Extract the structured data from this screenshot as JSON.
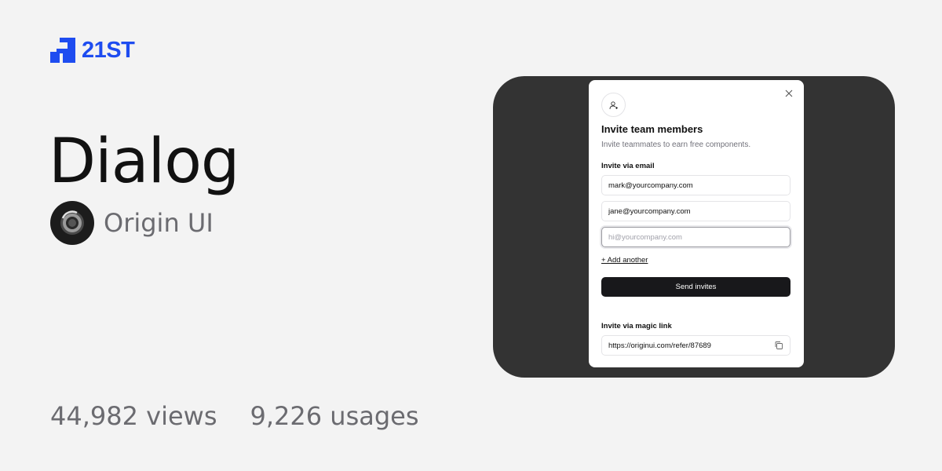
{
  "brand": {
    "name": "21ST",
    "color": "#1e4cf0",
    "icon": "21st-logo-icon"
  },
  "component": {
    "title": "Dialog",
    "author": "Origin UI",
    "author_icon": "origin-ui-avatar"
  },
  "stats": {
    "views": "44,982 views",
    "usages": "9,226 usages"
  },
  "dialog": {
    "close_icon": "close-icon",
    "header_icon": "user-plus-icon",
    "title": "Invite team members",
    "description": "Invite teammates to earn free components.",
    "email_label": "Invite via email",
    "emails": [
      {
        "value": "mark@yourcompany.com",
        "placeholder": ""
      },
      {
        "value": "jane@yourcompany.com",
        "placeholder": ""
      },
      {
        "value": "",
        "placeholder": "hi@yourcompany.com"
      }
    ],
    "add_another": "+ Add another",
    "send_button": "Send invites",
    "magic_label": "Invite via magic link",
    "magic_link": "https://originui.com/refer/87689",
    "copy_icon": "copy-icon"
  },
  "colors": {
    "background": "#f3f3f3",
    "preview_bg": "#333333",
    "primary_button": "#18181b"
  }
}
